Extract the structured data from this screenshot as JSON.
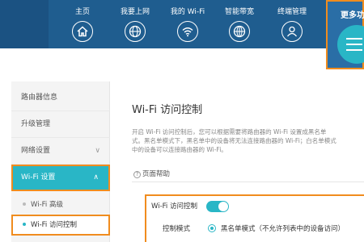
{
  "nav": {
    "items": [
      {
        "label": "主页",
        "icon": "home-icon"
      },
      {
        "label": "我要上网",
        "icon": "globe-icon"
      },
      {
        "label": "我的 Wi-Fi",
        "icon": "wifi-icon"
      },
      {
        "label": "智能带宽",
        "icon": "bandwidth-globe-icon"
      },
      {
        "label": "终端管理",
        "icon": "user-icon"
      }
    ],
    "more_label": "更多功",
    "more_icon": "menu-icon"
  },
  "sidebar": {
    "items": [
      {
        "label": "路由器信息"
      },
      {
        "label": "升级管理"
      },
      {
        "label": "网络设置",
        "chevron": "∨"
      },
      {
        "label": "Wi-Fi 设置",
        "chevron": "∧"
      }
    ],
    "subitems": [
      {
        "label": "Wi-Fi 高级"
      },
      {
        "label": "Wi-Fi 访问控制"
      }
    ]
  },
  "main": {
    "title": "Wi-Fi 访问控制",
    "desc_line1": "开启 Wi-Fi 访问控制后，您可以根据需要将路由器的 Wi-Fi 设置成黑名单",
    "desc_line2": "式。黑名单模式下，黑名单中的设备将无法连接路由器的 Wi-Fi；白名单模式",
    "desc_line3": "中的设备可以连接路由器的 Wi-Fi。",
    "help_label": "页面帮助",
    "access_control_label": "Wi-Fi 访问控制",
    "access_control_on": true,
    "mode_label": "控制模式",
    "mode_option1": "黑名单模式（不允许列表中的设备访问）"
  },
  "colors": {
    "nav_bg": "#1f5d8f",
    "accent": "#29b6c6",
    "highlight_border": "#f08c1e"
  }
}
